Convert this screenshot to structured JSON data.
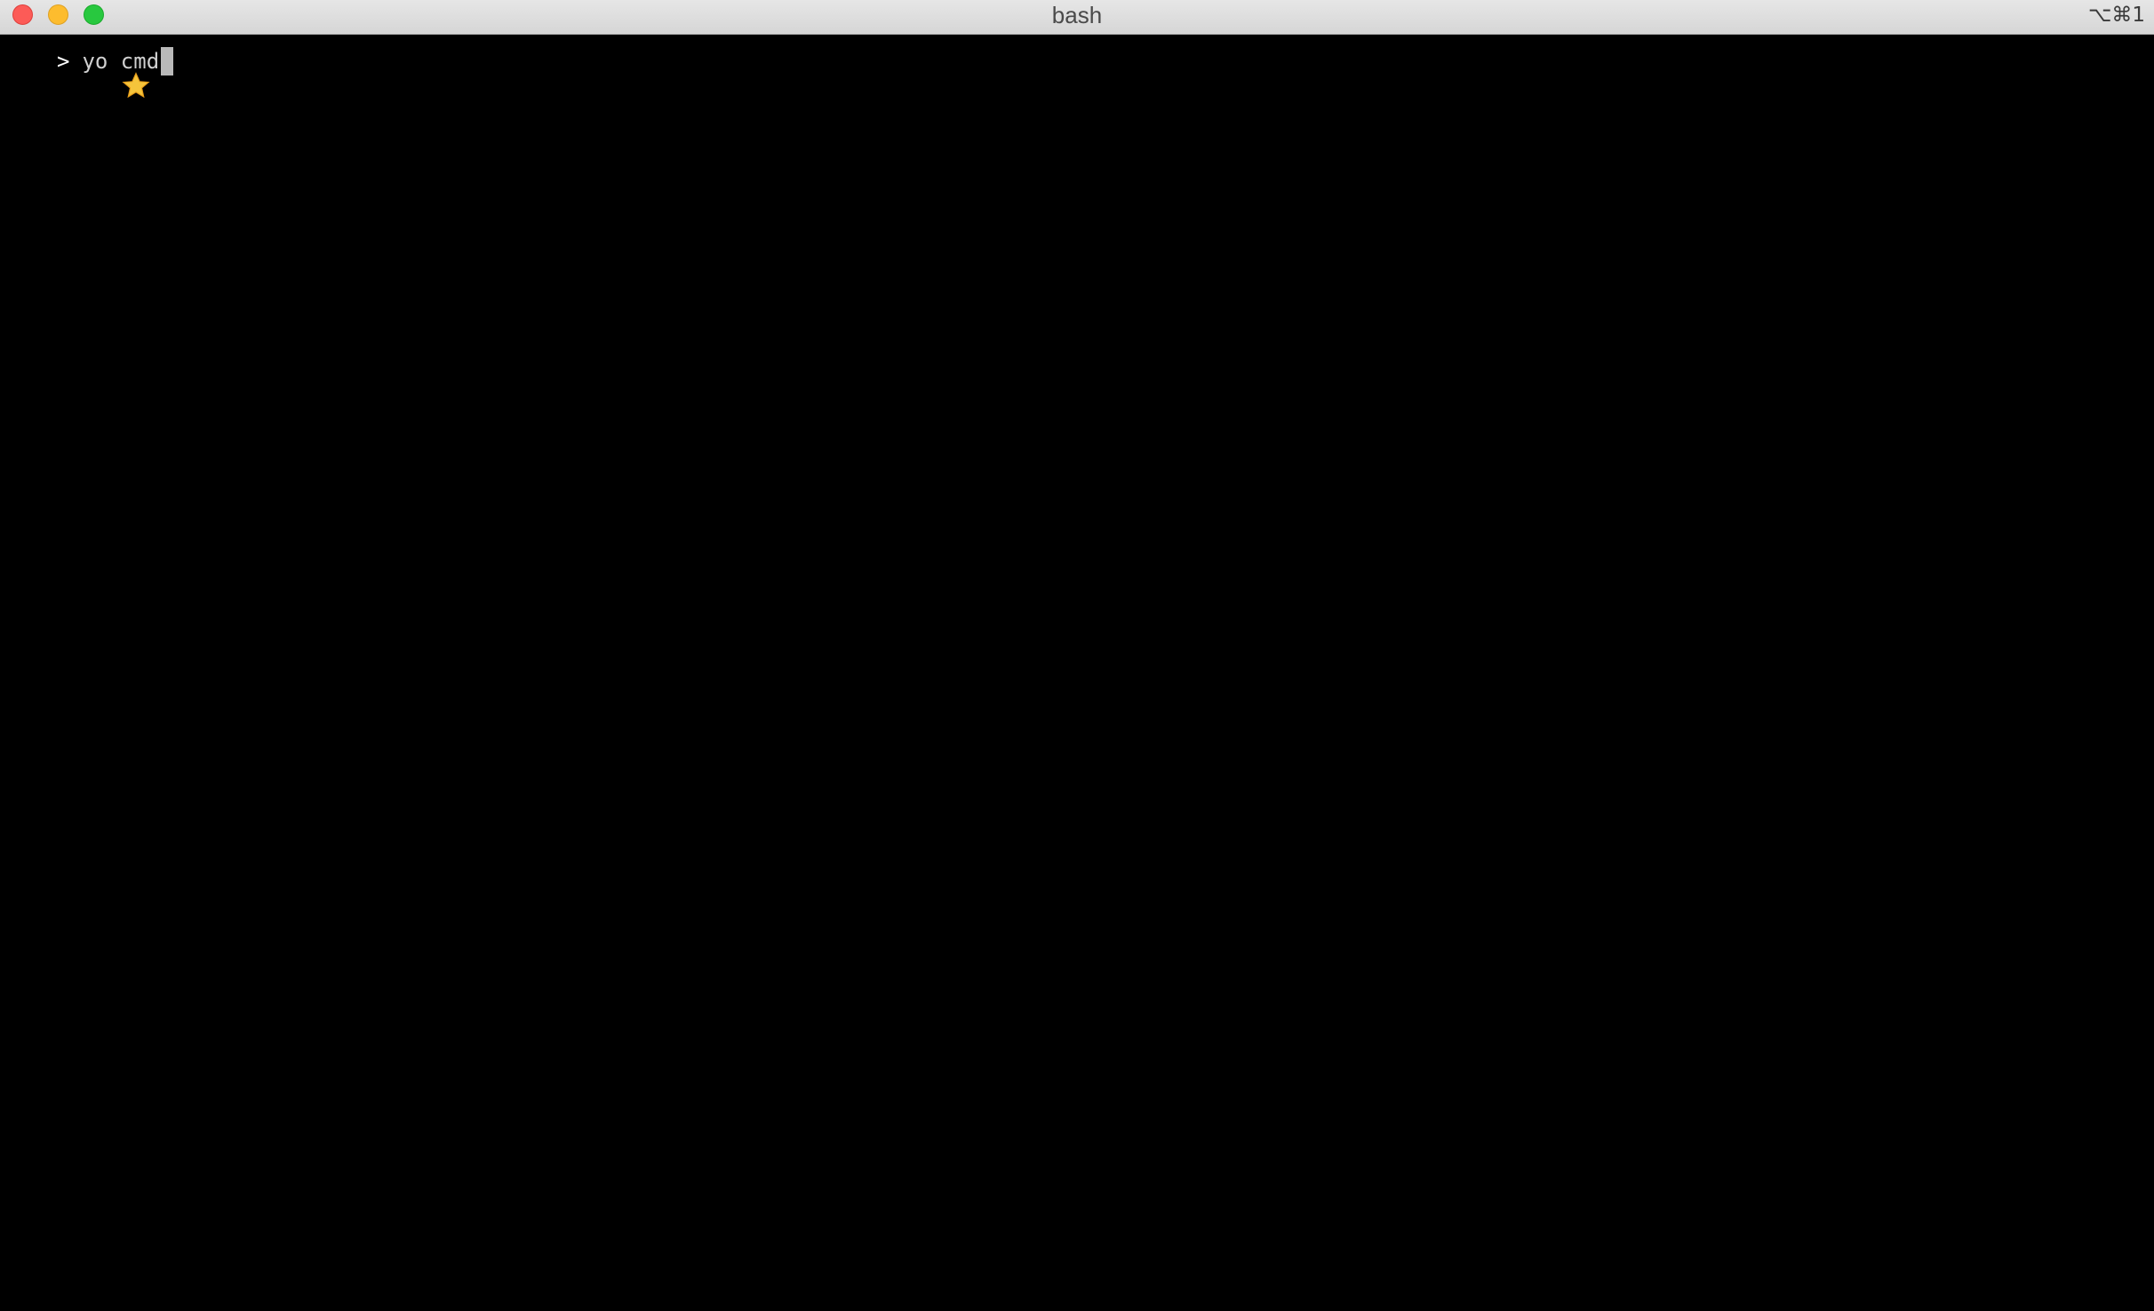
{
  "window": {
    "title": "bash",
    "shortcut": "⌥⌘1"
  },
  "terminal": {
    "prompt_icon": "star-icon",
    "prompt_symbol": ">",
    "command": "yo cmd"
  },
  "colors": {
    "background": "#000000",
    "close": "#fc5b57",
    "minimize": "#fdbc2e",
    "zoom": "#28c83f",
    "star": "#f5c43b"
  }
}
